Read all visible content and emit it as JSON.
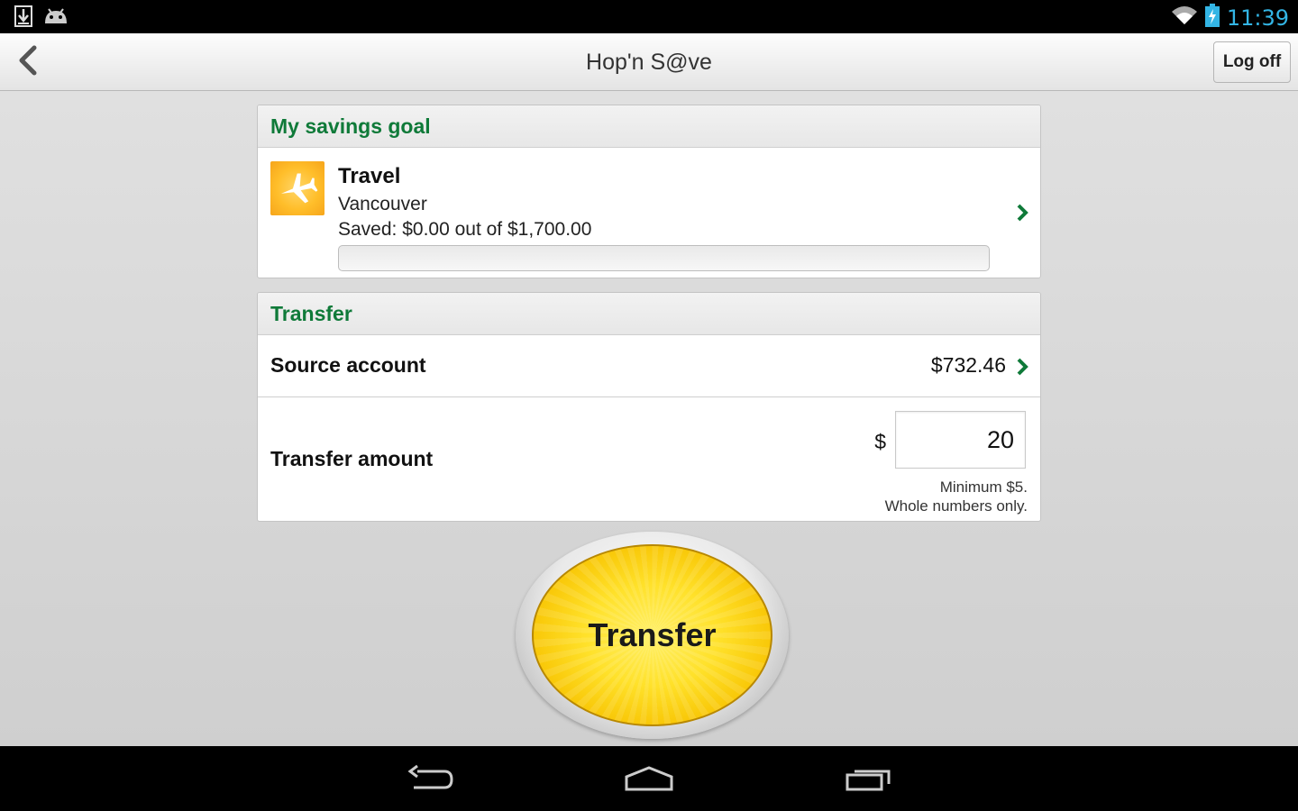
{
  "status_bar": {
    "time": "11:39",
    "icons": [
      "download-icon",
      "android-icon",
      "wifi-icon",
      "battery-charging-icon"
    ]
  },
  "action_bar": {
    "title": "Hop'n S@ve",
    "back_icon": "chevron-left-icon",
    "logoff_label": "Log off"
  },
  "savings_goal": {
    "header": "My savings goal",
    "icon": "airplane-icon",
    "title": "Travel",
    "destination": "Vancouver",
    "saved_text": "Saved: $0.00 out of $1,700.00",
    "progress_percent": 0
  },
  "transfer": {
    "header": "Transfer",
    "source_label": "Source account",
    "source_value": "$732.46",
    "amount_label": "Transfer amount",
    "currency": "$",
    "amount_value": "20",
    "hint_line1": "Minimum $5.",
    "hint_line2": "Whole numbers only."
  },
  "transfer_button": {
    "label": "Transfer"
  },
  "nav_bar": {
    "icons": [
      "back-nav-icon",
      "home-nav-icon",
      "recent-apps-icon"
    ]
  },
  "colors": {
    "accent_green": "#0f7a39",
    "status_time_blue": "#33b5e5",
    "button_yellow": "#ffe12a"
  }
}
